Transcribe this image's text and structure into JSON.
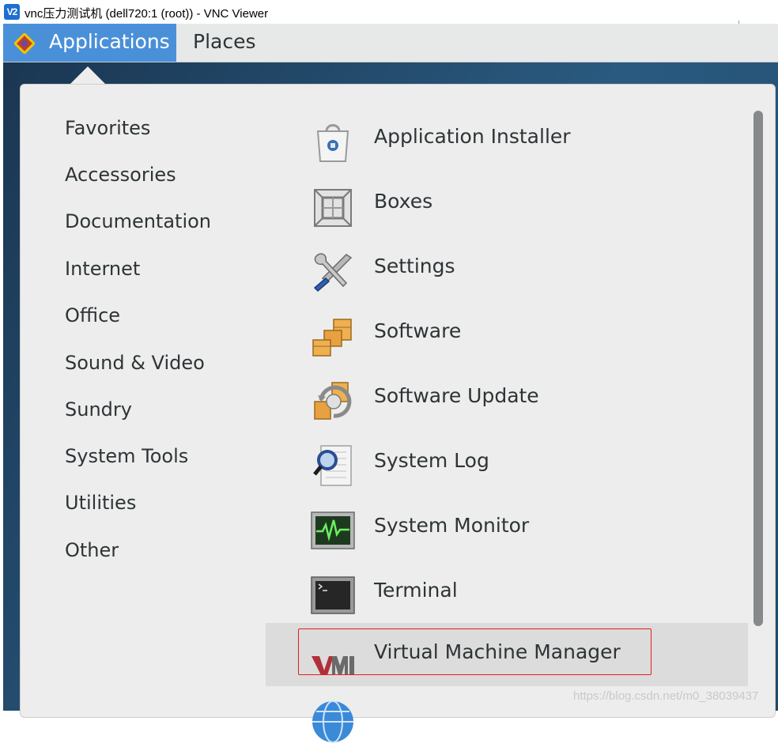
{
  "window": {
    "logo_text": "V2",
    "title": "vnc压力测试机 (dell720:1 (root)) - VNC Viewer"
  },
  "panel": {
    "applications_label": "Applications",
    "places_label": "Places"
  },
  "categories": [
    "Favorites",
    "Accessories",
    "Documentation",
    "Internet",
    "Office",
    "Sound & Video",
    "Sundry",
    "System Tools",
    "Utilities",
    "Other"
  ],
  "apps": [
    {
      "label": "Application Installer",
      "icon": "application-installer-icon"
    },
    {
      "label": "Boxes",
      "icon": "boxes-icon"
    },
    {
      "label": "Settings",
      "icon": "settings-icon"
    },
    {
      "label": "Software",
      "icon": "software-icon"
    },
    {
      "label": "Software Update",
      "icon": "software-update-icon"
    },
    {
      "label": "System Log",
      "icon": "system-log-icon"
    },
    {
      "label": "System Monitor",
      "icon": "system-monitor-icon"
    },
    {
      "label": "Terminal",
      "icon": "terminal-icon"
    },
    {
      "label": "Virtual Machine Manager",
      "icon": "virtual-machine-manager-icon",
      "selected": true
    },
    {
      "label": "",
      "icon": "globe-icon"
    }
  ],
  "colors": {
    "panel_active": "#4a90d9",
    "highlight_border": "#e02020"
  },
  "watermark": "https://blog.csdn.net/m0_38039437"
}
